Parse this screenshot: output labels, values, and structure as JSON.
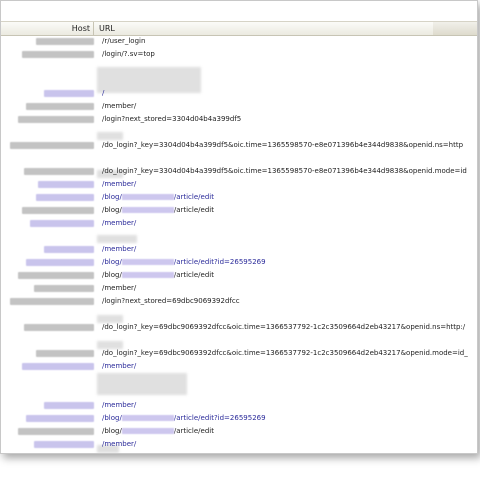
{
  "header": {
    "host_label": "Host",
    "url_label": "URL"
  },
  "requests": [
    {
      "url": "/r/user_login",
      "type": "plain",
      "host": "gray"
    },
    {
      "url": "/login/?.sv=top",
      "type": "plain",
      "host": "gray"
    },
    {
      "url": "",
      "type": "blank",
      "host": "none"
    },
    {
      "url": "",
      "type": "blank",
      "host": "none"
    },
    {
      "url": "/",
      "type": "link",
      "host": "blue"
    },
    {
      "url": "/member/",
      "type": "plain",
      "host": "gray"
    },
    {
      "url": "/login?next_stored=3304d04b4a399df5",
      "type": "plain",
      "host": "gray"
    },
    {
      "url": "",
      "type": "blank",
      "host": "none"
    },
    {
      "url": "/do_login?_key=3304d04b4a399df5&oic.time=1365598570-e8e071396b4e344d9838&openid.ns=http",
      "type": "plain",
      "host": "gray"
    },
    {
      "url": "",
      "type": "blank",
      "host": "none"
    },
    {
      "url": "/do_login?_key=3304d04b4a399df5&oic.time=1365598570-e8e071396b4e344d9838&openid.mode=id",
      "type": "plain",
      "host": "gray"
    },
    {
      "url": "/member/",
      "type": "link",
      "host": "blue"
    },
    {
      "url_prefix": "/blog/",
      "url_suffix": "/article/edit",
      "type": "link-blur",
      "host": "blue"
    },
    {
      "url_prefix": "/blog/",
      "url_suffix": "/article/edit",
      "type": "plain-blur",
      "host": "gray"
    },
    {
      "url": "/member/",
      "type": "link",
      "host": "blue"
    },
    {
      "url": "",
      "type": "blank",
      "host": "none"
    },
    {
      "url": "/member/",
      "type": "link",
      "host": "blue"
    },
    {
      "url_prefix": "/blog/",
      "url_suffix": "/article/edit?id=26595269",
      "type": "link-blur",
      "host": "blue"
    },
    {
      "url_prefix": "/blog/",
      "url_suffix": "/article/edit",
      "type": "plain-blur",
      "host": "gray"
    },
    {
      "url": "/member/",
      "type": "plain",
      "host": "gray"
    },
    {
      "url": "/login?next_stored=69dbc9069392dfcc",
      "type": "plain",
      "host": "gray"
    },
    {
      "url": "",
      "type": "blank",
      "host": "none"
    },
    {
      "url": "/do_login?_key=69dbc9069392dfcc&oic.time=1366537792-1c2c3509664d2eb43217&openid.ns=http:/",
      "type": "plain",
      "host": "gray"
    },
    {
      "url": "",
      "type": "blank",
      "host": "none"
    },
    {
      "url": "/do_login?_key=69dbc9069392dfcc&oic.time=1366537792-1c2c3509664d2eb43217&openid.mode=id_",
      "type": "plain",
      "host": "gray"
    },
    {
      "url": "/member/",
      "type": "link",
      "host": "blue"
    },
    {
      "url": "",
      "type": "blank",
      "host": "none"
    },
    {
      "url": "",
      "type": "blank",
      "host": "none"
    },
    {
      "url": "/member/",
      "type": "link",
      "host": "blue"
    },
    {
      "url_prefix": "/blog/",
      "url_suffix": "/article/edit?id=26595269",
      "type": "link-blur",
      "host": "blue"
    },
    {
      "url_prefix": "/blog/",
      "url_suffix": "/article/edit",
      "type": "plain-blur",
      "host": "gray"
    },
    {
      "url": "/member/",
      "type": "link",
      "host": "blue"
    }
  ]
}
